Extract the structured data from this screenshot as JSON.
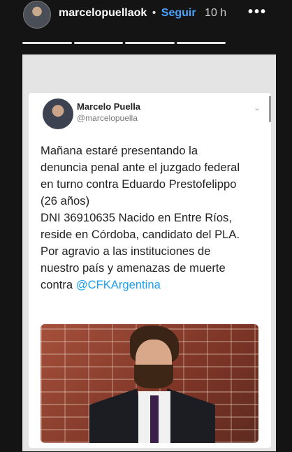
{
  "story": {
    "username": "marcelopuellaok",
    "dot": "•",
    "follow_label": "Seguir",
    "time": "10 h",
    "more_icon": "•••",
    "progress_segments": 4
  },
  "tweet": {
    "display_name": "Marcelo Puella",
    "handle": "@marcelopuella",
    "chevron": "⌄",
    "lines": [
      "Mañana estaré presentando la",
      "denuncia penal ante el juzgado federal",
      "en turno contra Eduardo Prestofelippo",
      "(26 años)",
      "DNI 36910635 Nacido en Entre Ríos,",
      "reside en Córdoba, candidato del PLA.",
      "Por agravio a las instituciones de",
      "nuestro país y amenazas de muerte"
    ],
    "last_line_prefix": "contra ",
    "mention": "@CFKArgentina"
  }
}
